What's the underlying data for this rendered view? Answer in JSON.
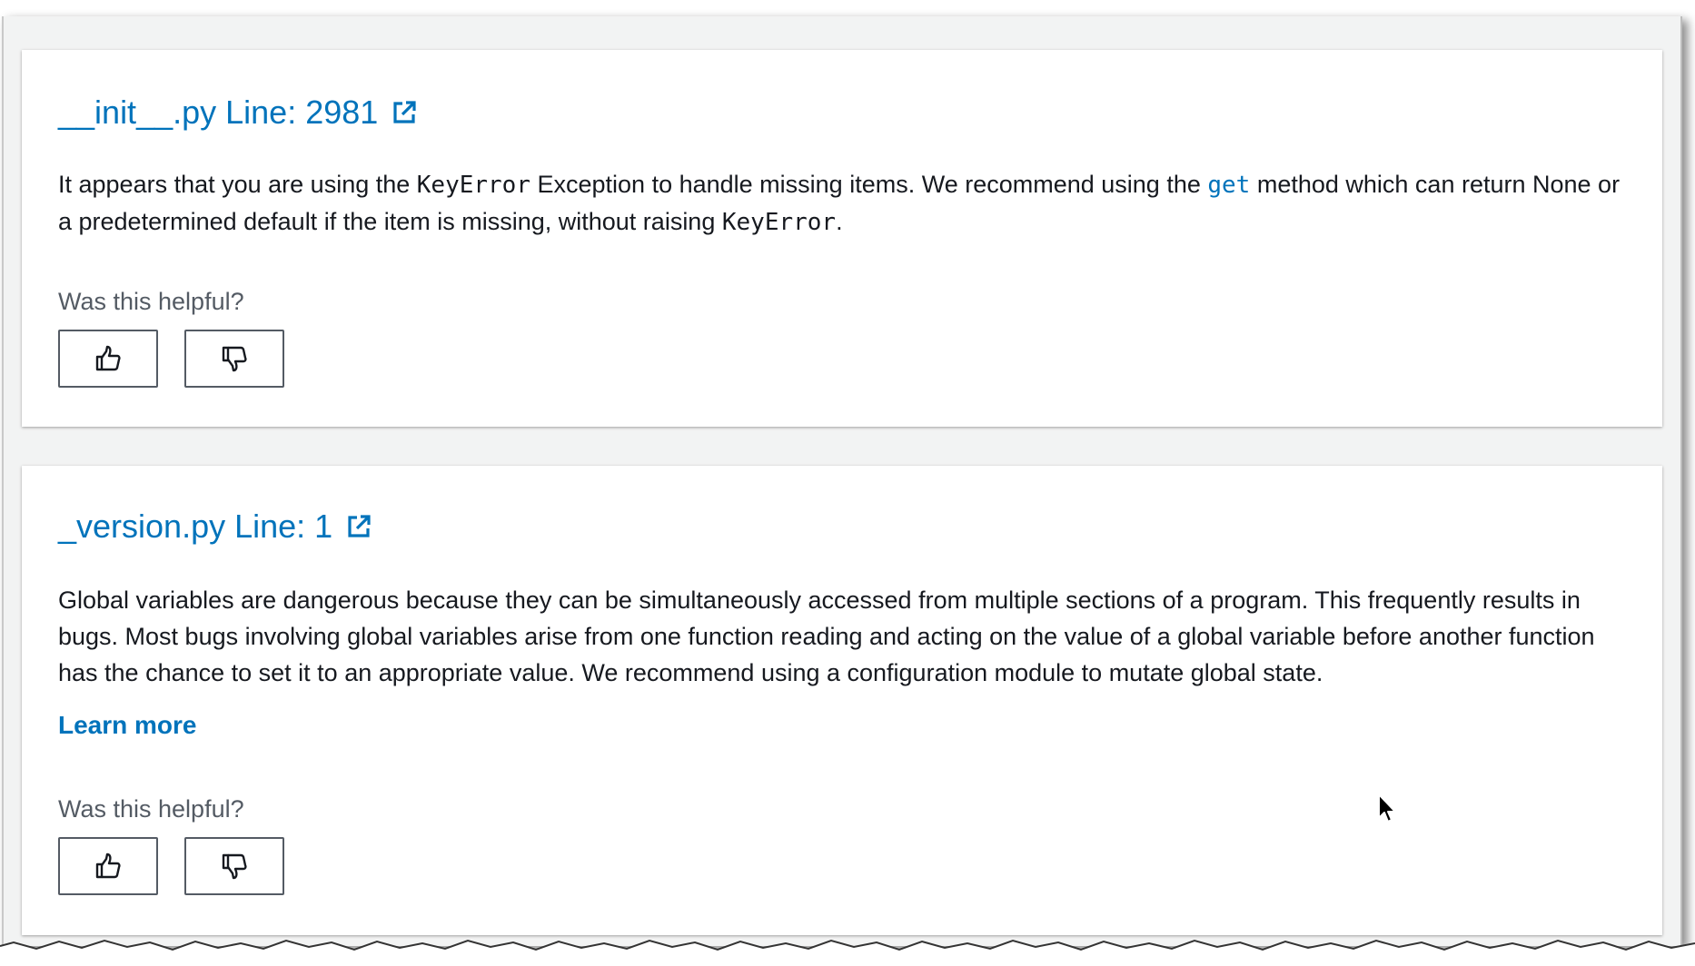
{
  "findings": [
    {
      "file_link": "__init__.py Line: 2981",
      "description_parts": {
        "p1": "It appears that you are using the ",
        "code1": "KeyError",
        "p2": " Exception to handle missing items. We recommend using the ",
        "code_link": "get",
        "p3": " method which can return None or a predetermined default if the item is missing, without raising ",
        "code2": "KeyError",
        "p4": "."
      },
      "helpful_label": "Was this helpful?",
      "thumbs_up_icon": "thumbs-up-icon",
      "thumbs_down_icon": "thumbs-down-icon"
    },
    {
      "file_link": "_version.py Line: 1",
      "description": "Global variables are dangerous because they can be simultaneously accessed from multiple sections of a program. This frequently results in bugs. Most bugs involving global variables arise from one function reading and acting on the value of a global variable before another function has the chance to set it to an appropriate value. We recommend using a configuration module to mutate global state.",
      "learn_more": "Learn more",
      "helpful_label": "Was this helpful?",
      "thumbs_up_icon": "thumbs-up-icon",
      "thumbs_down_icon": "thumbs-down-icon"
    }
  ],
  "colors": {
    "link": "#0073bb",
    "text": "#16191f",
    "secondary_text": "#545b64",
    "page_background": "#f2f3f3",
    "card_background": "#ffffff"
  },
  "external_link_icon": "external-link-icon",
  "cursor_icon": "mouse-pointer-icon"
}
